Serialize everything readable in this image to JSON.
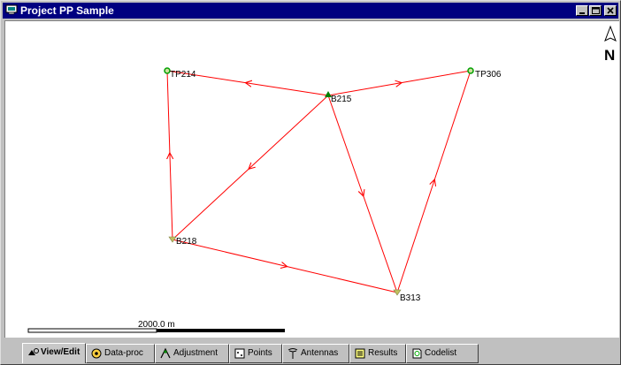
{
  "window": {
    "title": "Project PP Sample"
  },
  "map": {
    "points": [
      {
        "id": "TP214",
        "label": "TP214",
        "type": "control"
      },
      {
        "id": "B215",
        "label": "B215",
        "type": "reference"
      },
      {
        "id": "TP306",
        "label": "TP306",
        "type": "control"
      },
      {
        "id": "B218",
        "label": "B218",
        "type": "rover"
      },
      {
        "id": "B313",
        "label": "B313",
        "type": "rover"
      }
    ],
    "vectors": [
      {
        "from": "B215",
        "to": "TP214"
      },
      {
        "from": "B215",
        "to": "TP306"
      },
      {
        "from": "B215",
        "to": "B218"
      },
      {
        "from": "B215",
        "to": "B313"
      },
      {
        "from": "B218",
        "to": "TP214"
      },
      {
        "from": "B218",
        "to": "B313"
      },
      {
        "from": "B313",
        "to": "TP306"
      }
    ],
    "scale_label": "2000.0 m",
    "north_label": "N",
    "colors": {
      "vector": "#ff0000",
      "reference": "#008000",
      "control": "#00a000",
      "rover": "#c0c060"
    }
  },
  "tabs": [
    {
      "label": "View/Edit",
      "icon": "view-edit-icon",
      "active": true
    },
    {
      "label": "Data-proc",
      "icon": "data-proc-icon",
      "active": false
    },
    {
      "label": "Adjustment",
      "icon": "adjustment-icon",
      "active": false
    },
    {
      "label": "Points",
      "icon": "points-icon",
      "active": false
    },
    {
      "label": "Antennas",
      "icon": "antenna-icon",
      "active": false
    },
    {
      "label": "Results",
      "icon": "results-icon",
      "active": false
    },
    {
      "label": "Codelist",
      "icon": "codelist-icon",
      "active": false
    }
  ]
}
